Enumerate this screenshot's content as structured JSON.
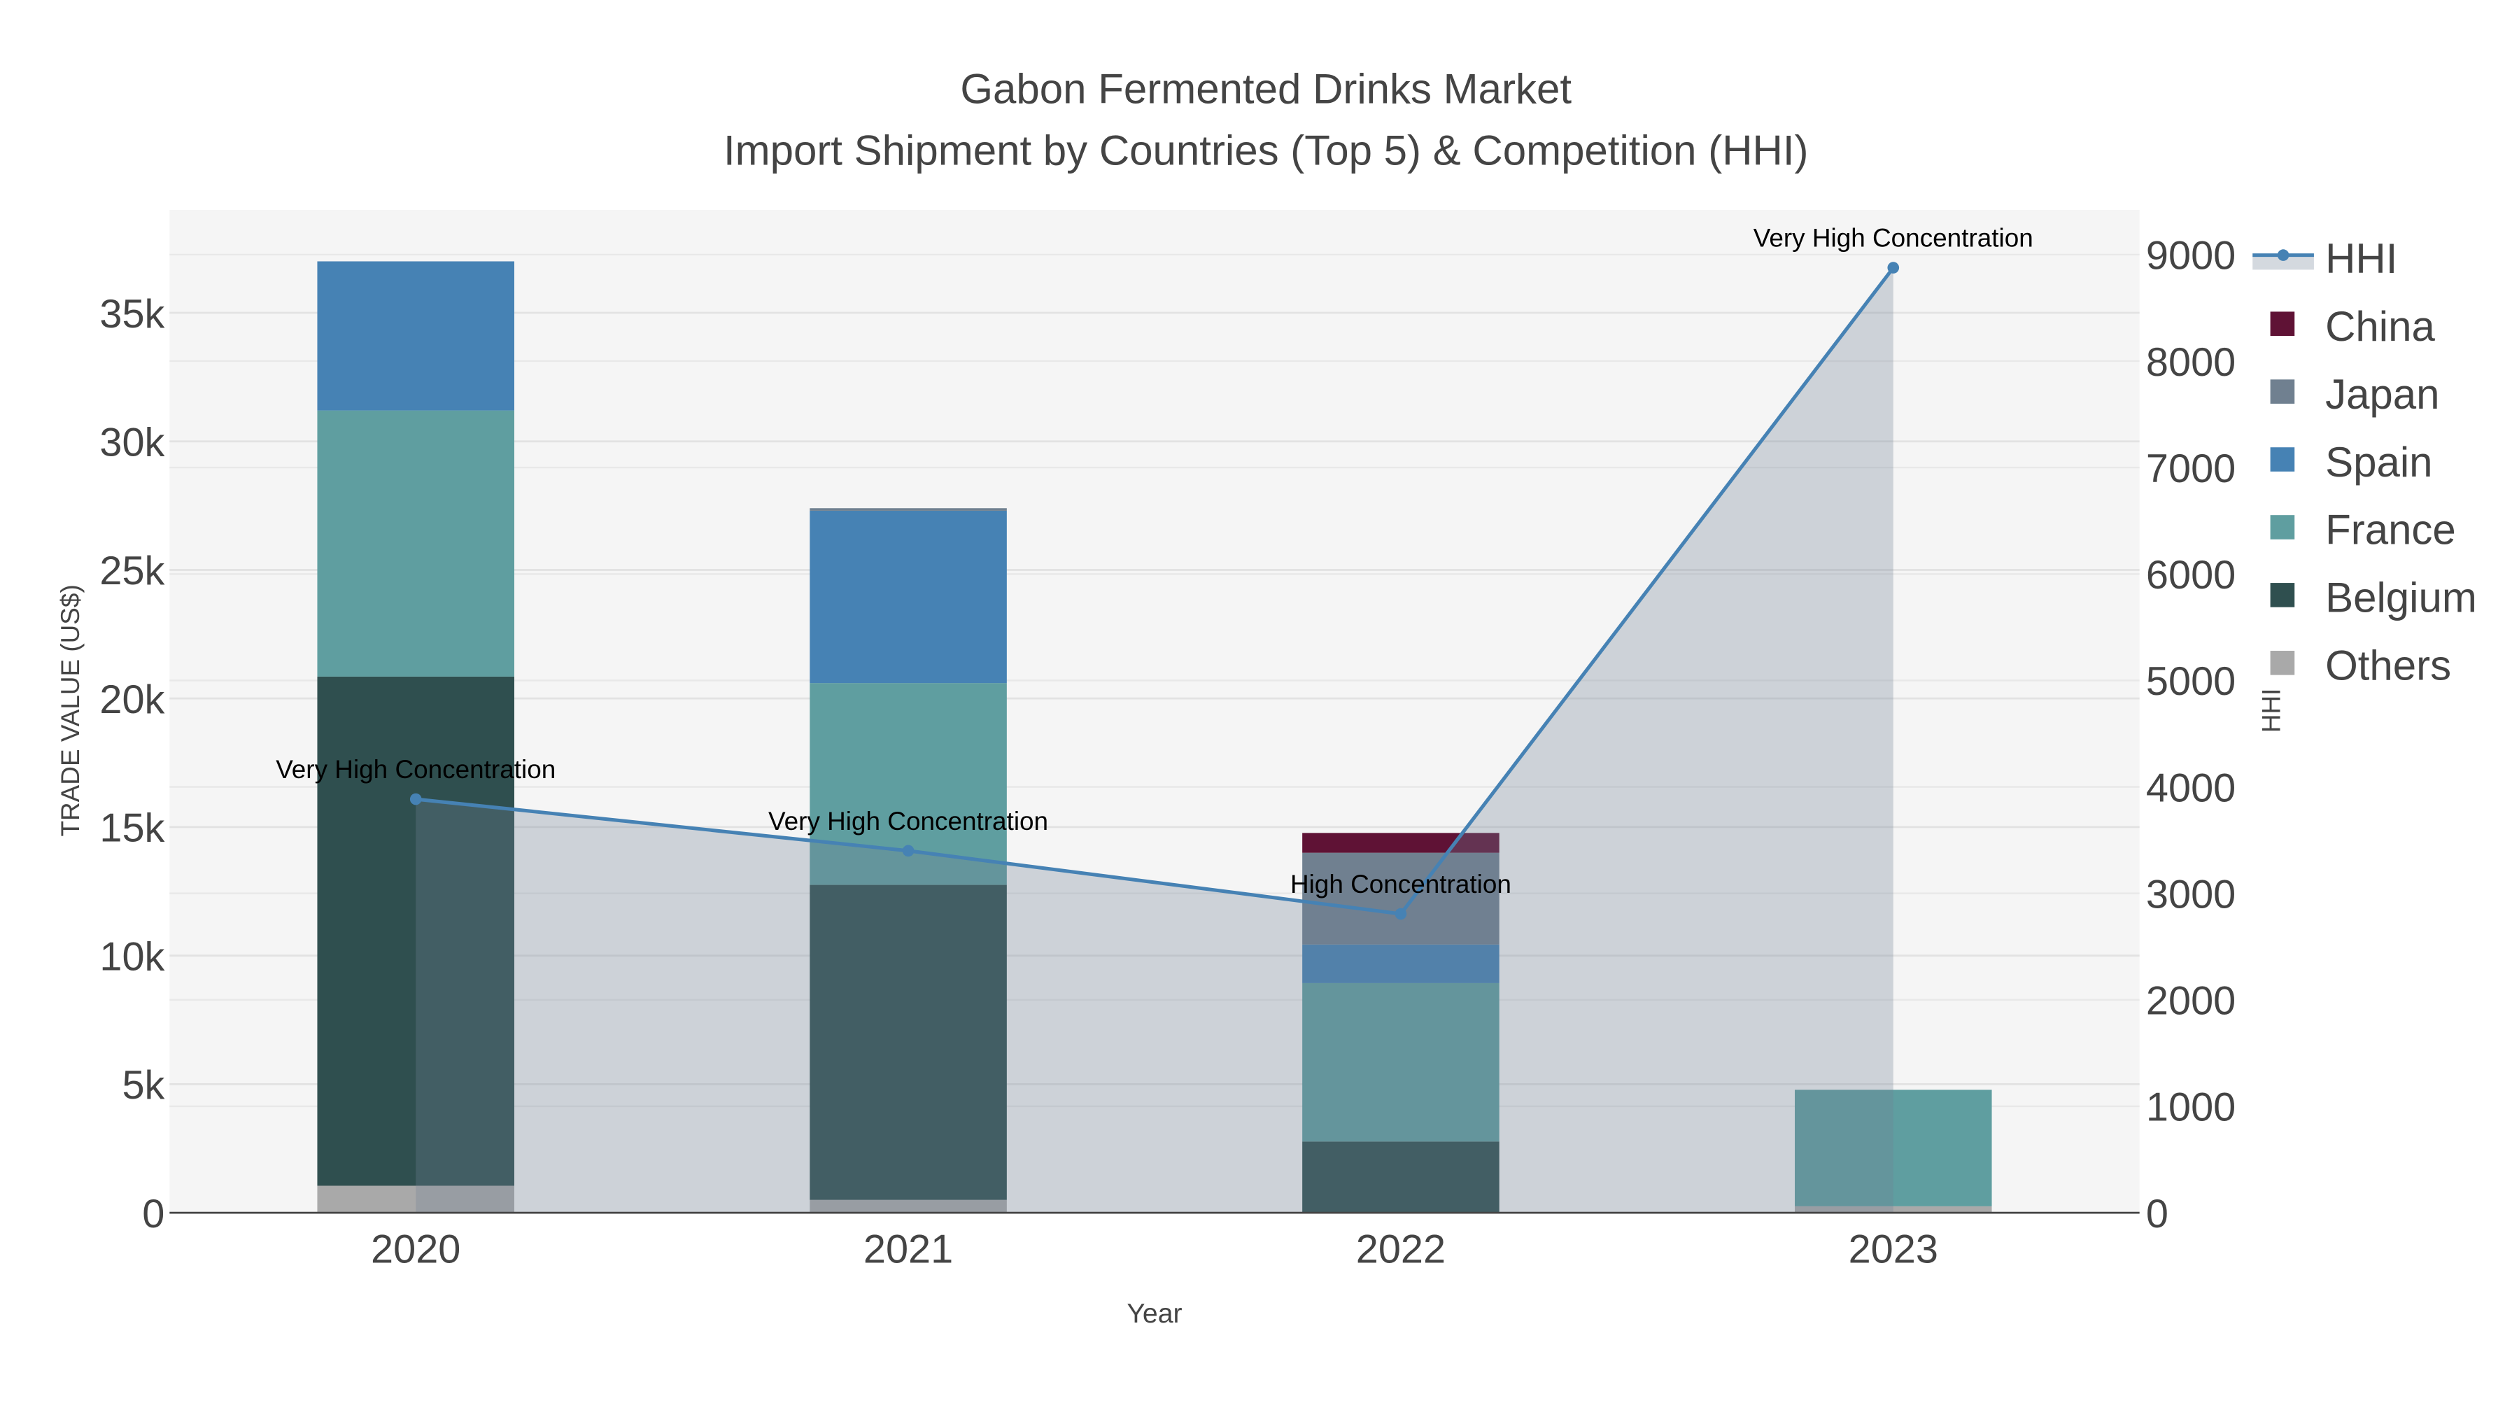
{
  "chart_data": {
    "type": "bar",
    "title": "Gabon Fermented Drinks Market",
    "subtitle": "Import Shipment by Countries (Top 5) & Competition (HHI)",
    "xlabel": "Year",
    "ylabel": "TRADE VALUE (US$)",
    "y2label": "HHI",
    "categories": [
      "2020",
      "2021",
      "2022",
      "2023"
    ],
    "ylim": [
      0,
      39000
    ],
    "y2lim": [
      0,
      9420
    ],
    "yticks": [
      0,
      5000,
      10000,
      15000,
      20000,
      25000,
      30000,
      35000
    ],
    "ytick_labels": [
      "0",
      "5k",
      "10k",
      "15k",
      "20k",
      "25k",
      "30k",
      "35k"
    ],
    "y2ticks": [
      0,
      1000,
      2000,
      3000,
      4000,
      5000,
      6000,
      7000,
      8000,
      9000
    ],
    "y2tick_labels": [
      "0",
      "1000",
      "2000",
      "3000",
      "4000",
      "5000",
      "6000",
      "7000",
      "8000",
      "9000"
    ],
    "grid": true,
    "legend_position": "right",
    "series": [
      {
        "name": "Others",
        "color": "#a9a9a9",
        "values": [
          1050,
          500,
          0,
          250
        ]
      },
      {
        "name": "Belgium",
        "color": "#2f4f4f",
        "values": [
          19800,
          12250,
          2770,
          0
        ]
      },
      {
        "name": "France",
        "color": "#5f9ea0",
        "values": [
          10350,
          7850,
          6160,
          4530
        ]
      },
      {
        "name": "Spain",
        "color": "#4682b4",
        "values": [
          5800,
          6700,
          1500,
          0
        ]
      },
      {
        "name": "Japan",
        "color": "#708090",
        "values": [
          0,
          100,
          3570,
          0
        ]
      },
      {
        "name": "China",
        "color": "#5f1235",
        "values": [
          0,
          0,
          770,
          0
        ]
      }
    ],
    "hhi": {
      "name": "HHI",
      "color": "#4682b4",
      "values": [
        3885,
        3400,
        2807,
        8877
      ],
      "annotations": [
        "Very High Concentration",
        "Very High Concentration",
        "High Concentration",
        "Very High Concentration"
      ]
    },
    "legend_order": [
      "HHI",
      "China",
      "Japan",
      "Spain",
      "France",
      "Belgium",
      "Others"
    ]
  }
}
